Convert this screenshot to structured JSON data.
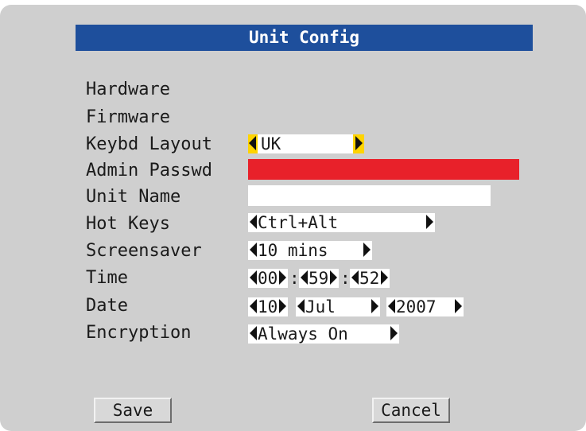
{
  "dialog": {
    "title": "Unit Config"
  },
  "labels": {
    "hardware": "Hardware",
    "firmware": "Firmware",
    "keybd_layout": "Keybd Layout",
    "admin_passwd": "Admin Passwd",
    "unit_name": "Unit Name",
    "hot_keys": "Hot Keys",
    "screensaver": "Screensaver",
    "time": "Time",
    "date": "Date",
    "encryption": "Encryption"
  },
  "values": {
    "keybd_layout": "UK",
    "admin_passwd": "",
    "unit_name": "",
    "hot_keys": "Ctrl+Alt",
    "screensaver": "10 mins",
    "time": {
      "hours": "00",
      "minutes": "59",
      "seconds": "52",
      "separator": ":"
    },
    "date": {
      "day": "10",
      "month": "Jul",
      "year": "2007"
    },
    "encryption": "Always On"
  },
  "buttons": {
    "save": "Save",
    "cancel": "Cancel"
  },
  "colors": {
    "panel_bg": "#cfcfcf",
    "title_bg": "#1e4f9c",
    "highlight_bg": "#e8212a",
    "selected_arrow_bg": "#ffd400"
  },
  "icons": {
    "left_arrow": "left-triangle-icon",
    "right_arrow": "right-triangle-icon"
  }
}
